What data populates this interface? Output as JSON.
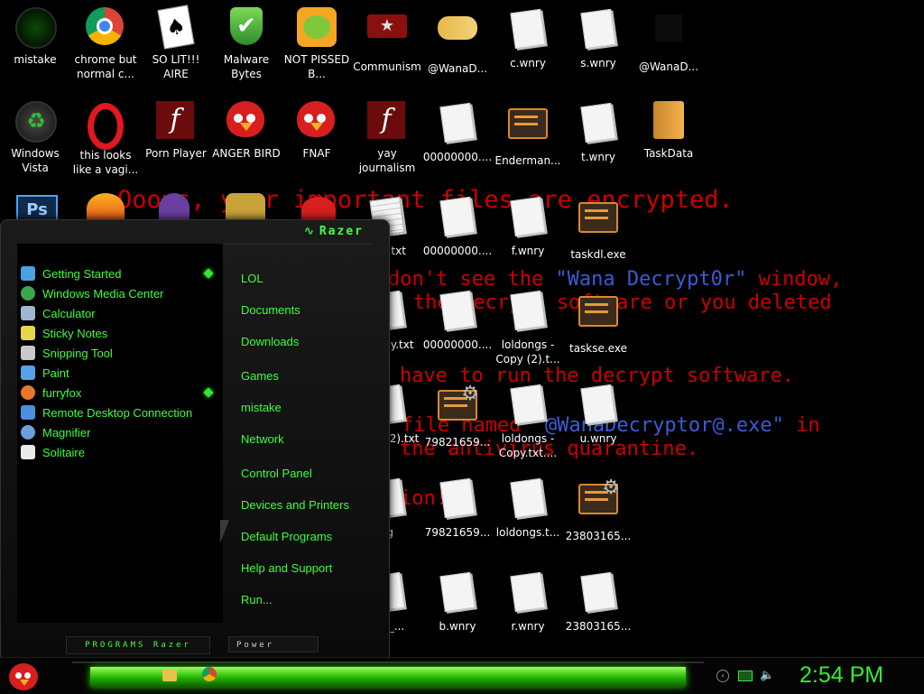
{
  "wallpaper": {
    "line1": "Ooops, your important files are encrypted.",
    "line2_start": "don't see the ",
    "line2_name": "\"Wana Decrypt0r\"",
    "line2_end": " window,",
    "line3": "the decrypt software or you deleted",
    "line4": "have to run the decrypt software.",
    "line5_start": "file named ",
    "line5_name": "\"@WanaDecryptor@.exe\"",
    "line5_end": " in",
    "line6": "the antivirus quarantine.",
    "line7": "ion!"
  },
  "desktop_icons": [
    {
      "label": "mistake",
      "icon": "recycle-icon"
    },
    {
      "label": "chrome but normal c...",
      "icon": "chrome-icon"
    },
    {
      "label": "SO LIT!!! AIRE",
      "icon": "cards-icon"
    },
    {
      "label": "Malware Bytes",
      "icon": "shield-icon"
    },
    {
      "label": "NOT PISSED B...",
      "icon": "pig-icon"
    },
    {
      "label": "Communism",
      "icon": "flag-icon"
    },
    {
      "label": "@WanaD...",
      "icon": "handshake-icon"
    },
    {
      "label": "c.wnry",
      "icon": "document-icon"
    },
    {
      "label": "s.wnry",
      "icon": "document-icon"
    },
    {
      "label": "@WanaD...",
      "icon": "blank-icon"
    },
    {
      "label": "Windows Vista",
      "icon": "recycle-icon"
    },
    {
      "label": "this looks like a vagi...",
      "icon": "opera-icon"
    },
    {
      "label": "Porn Player",
      "icon": "flash-icon"
    },
    {
      "label": "ANGER BIRD",
      "icon": "bird-icon"
    },
    {
      "label": "FNAF",
      "icon": "bird-icon"
    },
    {
      "label": "yay journalism",
      "icon": "flash-icon"
    },
    {
      "label": "00000000....",
      "icon": "document-icon"
    },
    {
      "label": "Enderman...",
      "icon": "exe-icon"
    },
    {
      "label": "t.wnry",
      "icon": "document-icon"
    },
    {
      "label": "TaskData",
      "icon": "folder-icon"
    },
    {
      "label": "ngs.txt",
      "icon": "document-icon"
    },
    {
      "label": "00000000....",
      "icon": "document-icon"
    },
    {
      "label": "f.wnry",
      "icon": "document-icon"
    },
    {
      "label": "taskdl.exe",
      "icon": "exe-icon"
    },
    {
      "label": "ngs - y.txt",
      "icon": "document-icon"
    },
    {
      "label": "00000000....",
      "icon": "document-icon"
    },
    {
      "label": "loldongs - Copy (2).t...",
      "icon": "document-icon"
    },
    {
      "label": "taskse.exe",
      "icon": "exe-icon"
    },
    {
      "label": "ngs - (2).txt",
      "icon": "document-icon"
    },
    {
      "label": "79821659...",
      "icon": "exe-gear-icon"
    },
    {
      "label": "loldongs - Copy.txt....",
      "icon": "document-icon"
    },
    {
      "label": "u.wnry",
      "icon": "document-icon"
    },
    {
      "label": "sg",
      "icon": "document-icon"
    },
    {
      "label": "79821659...",
      "icon": "document-icon"
    },
    {
      "label": "loldongs.t...",
      "icon": "document-icon"
    },
    {
      "label": "23803165...",
      "icon": "exe-gear-icon"
    },
    {
      "label": "ase_...",
      "icon": "document-icon"
    },
    {
      "label": "b.wnry",
      "icon": "document-icon"
    },
    {
      "label": "r.wnry",
      "icon": "document-icon"
    },
    {
      "label": "23803165...",
      "icon": "document-icon"
    }
  ],
  "start_menu": {
    "brand": "Razer",
    "programs": [
      {
        "label": "Getting Started",
        "icon": "getting-started-icon",
        "color": "#4aa3e0",
        "submenu": true
      },
      {
        "label": "Windows Media Center",
        "icon": "media-center-icon",
        "color": "#3aa84a",
        "submenu": false
      },
      {
        "label": "Calculator",
        "icon": "calculator-icon",
        "color": "#9fb6cf",
        "submenu": false
      },
      {
        "label": "Sticky Notes",
        "icon": "sticky-notes-icon",
        "color": "#e7d64a",
        "submenu": false
      },
      {
        "label": "Snipping Tool",
        "icon": "scissors-icon",
        "color": "#c9c9c9",
        "submenu": false
      },
      {
        "label": "Paint",
        "icon": "paint-icon",
        "color": "#5aa0e6",
        "submenu": false
      },
      {
        "label": "furryfox",
        "icon": "firefox-icon",
        "color": "#e8772a",
        "submenu": true
      },
      {
        "label": "Remote Desktop Connection",
        "icon": "remote-desktop-icon",
        "color": "#4b8fe0",
        "submenu": false
      },
      {
        "label": "Magnifier",
        "icon": "magnifier-icon",
        "color": "#6c9fdc",
        "submenu": false
      },
      {
        "label": "Solitaire",
        "icon": "cards-icon",
        "color": "#e9e9e9",
        "submenu": false
      }
    ],
    "places": [
      "LOL",
      "Documents",
      "Downloads",
      "Games",
      "mistake",
      "Network",
      "Control Panel",
      "Devices and Printers",
      "Default Programs",
      "Help and Support",
      "Run..."
    ],
    "all_programs_label": "PROGRAMS Razer",
    "power_label": "Power"
  },
  "taskbar": {
    "clock": "2:54 PM",
    "apps": [
      "explorer-icon",
      "chrome-icon"
    ],
    "tray": [
      "back-icon",
      "battery-icon",
      "volume-icon"
    ]
  }
}
